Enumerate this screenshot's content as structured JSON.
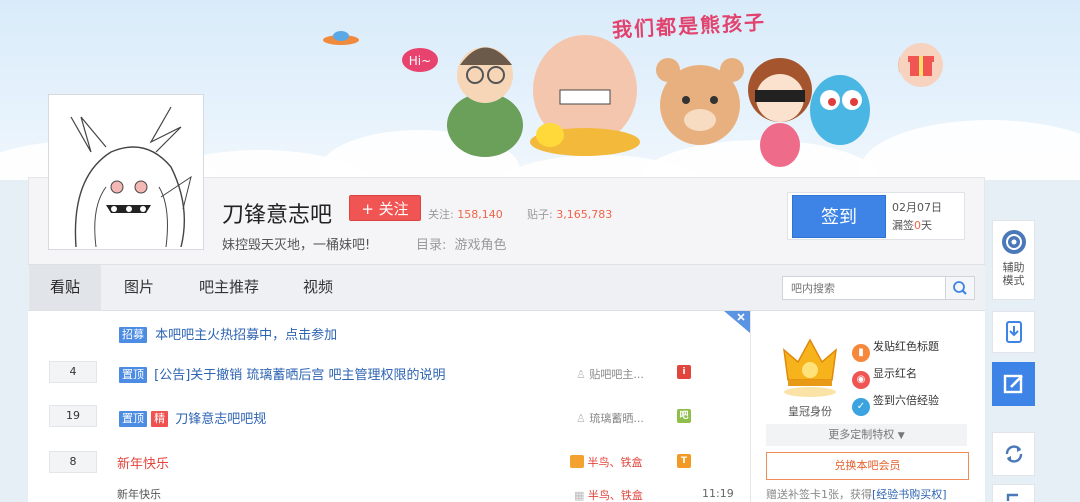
{
  "banner": {
    "slogan": "我们都是熊孩子",
    "speech": "Hi~"
  },
  "forum": {
    "name": "刀锋意志吧",
    "follow_label": "+ 关注",
    "follow_prefix": "关注:",
    "follow_count": "158,140",
    "posts_prefix": "贴子:",
    "posts_count": "3,165,783",
    "slogan": "妹控毁天灭地，一桶妹吧!",
    "catalog_label": "目录:",
    "catalog_value": "游戏角色"
  },
  "sign": {
    "button": "签到",
    "date": "02月07日",
    "missed_prefix": "漏签",
    "missed_count": "0",
    "missed_suffix": "天"
  },
  "nav": {
    "tabs": [
      "看贴",
      "图片",
      "吧主推荐",
      "视频"
    ],
    "search_placeholder": "吧内搜索"
  },
  "threads": {
    "recruit": {
      "tag": "招募",
      "title": "本吧吧主火热招募中，点击参加"
    },
    "rows": [
      {
        "replies": "4",
        "tags": [
          "置顶"
        ],
        "title": "[公告]关于撤销 琉璃蓄晒后宫 吧主管理权限的说明",
        "author": "贴吧吧主...",
        "badge": "i"
      },
      {
        "replies": "19",
        "tags": [
          "置顶",
          "精"
        ],
        "title": "刀锋意志吧吧规",
        "author": "琉璃蓄晒...",
        "badge": "吧"
      },
      {
        "replies": "8",
        "tags": [],
        "title": "新年快乐",
        "author": "半鸟、铁盒",
        "badge": "T"
      }
    ],
    "preview": {
      "text": "新年快乐",
      "author": "半鸟、铁盒",
      "time": "11:19"
    }
  },
  "side": {
    "crown_label": "皇冠身份",
    "perks": [
      "发贴红色标题",
      "显示红名",
      "签到六倍经验"
    ],
    "more_perks": "更多定制特权",
    "member_button": "兑换本吧会员",
    "gift_prefix": "赠送补签卡1张，获得",
    "gift_link": "[经验书购买权]"
  },
  "dock": {
    "assist_label": "辅助模式"
  },
  "colors": {
    "accent": "#3d84e6",
    "follow": "#f05554",
    "link": "#2d64b3"
  }
}
